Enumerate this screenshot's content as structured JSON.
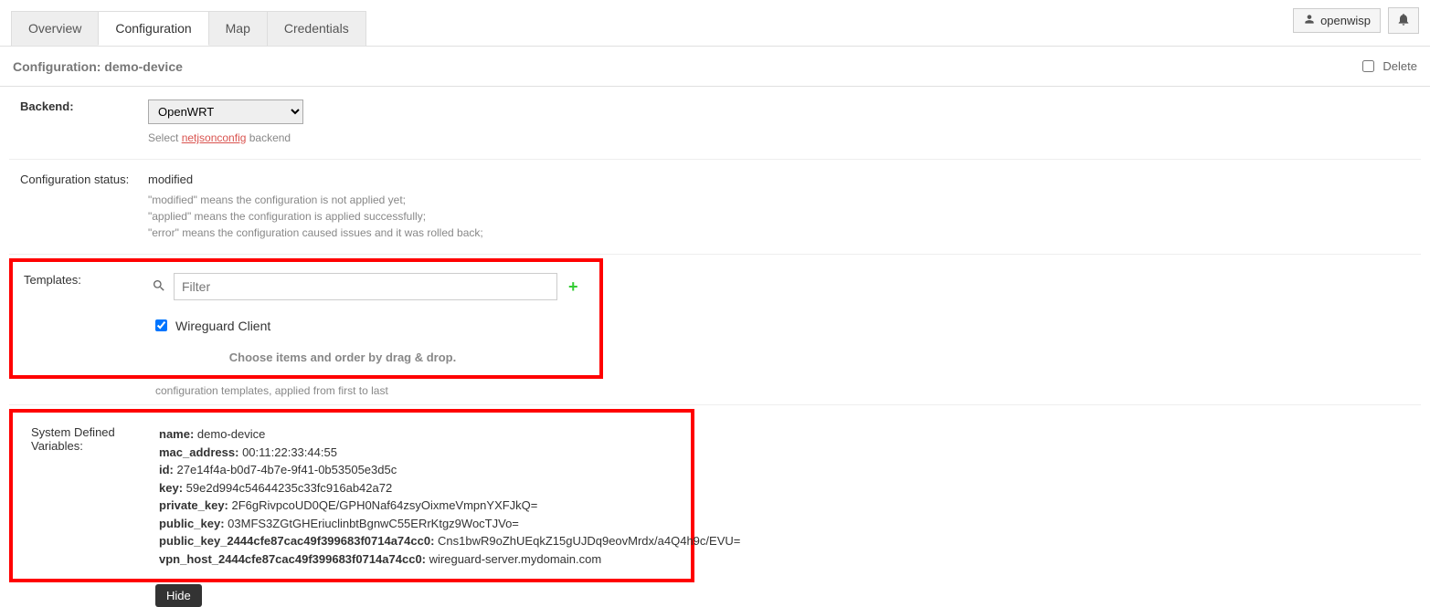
{
  "user": {
    "name": "openwisp"
  },
  "tabs": [
    {
      "label": "Overview"
    },
    {
      "label": "Configuration"
    },
    {
      "label": "Map"
    },
    {
      "label": "Credentials"
    }
  ],
  "page_title": "Configuration: demo-device",
  "delete_label": "Delete",
  "backend": {
    "label": "Backend:",
    "value": "OpenWRT",
    "help_prefix": "Select ",
    "help_link": "netjsonconfig",
    "help_suffix": " backend"
  },
  "config_status": {
    "label": "Configuration status:",
    "value": "modified",
    "help_line1": "\"modified\" means the configuration is not applied yet;",
    "help_line2": "\"applied\" means the configuration is applied successfully;",
    "help_line3": "\"error\" means the configuration caused issues and it was rolled back;"
  },
  "templates": {
    "label": "Templates:",
    "filter_placeholder": "Filter",
    "item_label": "Wireguard Client",
    "drag_help": "Choose items and order by drag & drop.",
    "applied_help": "configuration templates, applied from first to last"
  },
  "sysvars": {
    "label": "System Defined Variables:",
    "items": [
      {
        "k": "name:",
        "v": "demo-device"
      },
      {
        "k": "mac_address:",
        "v": "00:11:22:33:44:55"
      },
      {
        "k": "id:",
        "v": "27e14f4a-b0d7-4b7e-9f41-0b53505e3d5c"
      },
      {
        "k": "key:",
        "v": "59e2d994c54644235c33fc916ab42a72"
      },
      {
        "k": "private_key:",
        "v": "2F6gRivpcoUD0QE/GPH0Naf64zsyOixmeVmpnYXFJkQ="
      },
      {
        "k": "public_key:",
        "v": "03MFS3ZGtGHEriuclinbtBgnwC55ERrKtgz9WocTJVo="
      },
      {
        "k": "public_key_2444cfe87cac49f399683f0714a74cc0:",
        "v": "Cns1bwR9oZhUEqkZ15gUJDq9eovMrdx/a4Q4h9c/EVU="
      },
      {
        "k": "vpn_host_2444cfe87cac49f399683f0714a74cc0:",
        "v": "wireguard-server.mydomain.com"
      }
    ]
  },
  "hide_label": "Hide"
}
